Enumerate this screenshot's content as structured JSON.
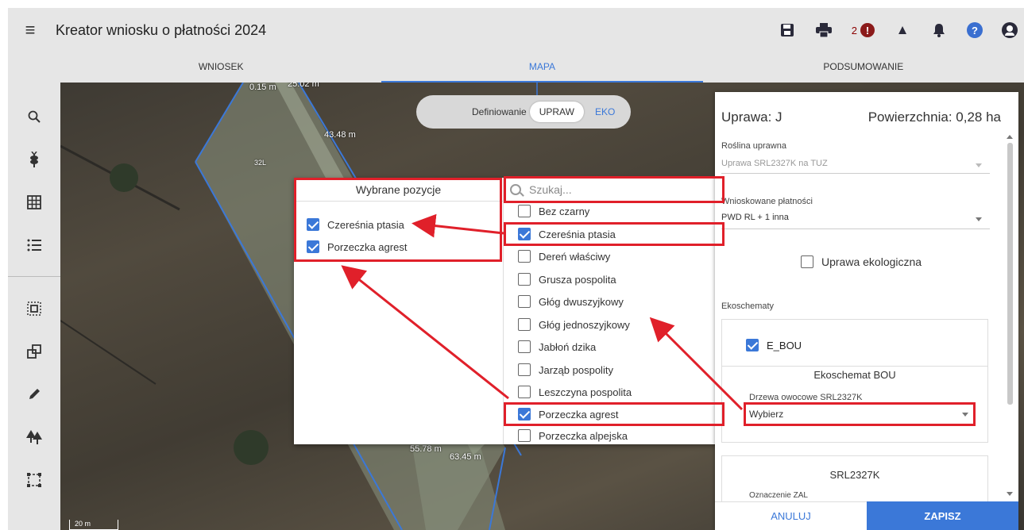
{
  "app_title": "Kreator wniosku o płatności 2024",
  "header": {
    "error_count": "2",
    "error_glyph": "!",
    "warning_glyph": "▲",
    "help_glyph": "?"
  },
  "tabs": [
    {
      "label": "WNIOSEK"
    },
    {
      "label": "MAPA"
    },
    {
      "label": "PODSUMOWANIE"
    }
  ],
  "map": {
    "labels": [
      "0.15 m",
      "25.02 m",
      "43.48 m",
      "32L",
      "63.45 m",
      "55.78 m"
    ],
    "scale": "20 m",
    "mode_toggle": {
      "prefix": "Definiowanie",
      "option_a": "UPRAW",
      "option_b": "EKO"
    }
  },
  "picker": {
    "selected_title": "Wybrane pozycje",
    "selected": [
      {
        "label": "Czereśnia ptasia",
        "checked": true
      },
      {
        "label": "Porzeczka agrest",
        "checked": true
      }
    ],
    "search_placeholder": "Szukaj...",
    "options": [
      {
        "label": "Bez czarny",
        "checked": false
      },
      {
        "label": "Czereśnia ptasia",
        "checked": true
      },
      {
        "label": "Dereń właściwy",
        "checked": false
      },
      {
        "label": "Grusza pospolita",
        "checked": false
      },
      {
        "label": "Głóg dwuszyjkowy",
        "checked": false
      },
      {
        "label": "Głóg jednoszyjkowy",
        "checked": false
      },
      {
        "label": "Jabłoń dzika",
        "checked": false
      },
      {
        "label": "Jarząb pospolity",
        "checked": false
      },
      {
        "label": "Leszczyna pospolita",
        "checked": false
      },
      {
        "label": "Porzeczka agrest",
        "checked": true
      },
      {
        "label": "Porzeczka alpejska",
        "checked": false
      }
    ]
  },
  "panel": {
    "crop_title": "Uprawa: J",
    "area": "Powierzchnia: 0,28 ha",
    "plant_label": "Roślina uprawna",
    "plant_value": "Uprawa SRL2327K na TUZ",
    "payments_label": "Wnioskowane płatności",
    "payments_value": "PWD RL + 1 inna",
    "organic_label": "Uprawa ekologiczna",
    "eco_label": "Ekoschematy",
    "eco_checkbox": "E_BOU",
    "eco_card_title": "Ekoschemat BOU",
    "trees_label": "Drzewa owocowe SRL2327K",
    "trees_value": "Wybierz",
    "srl_title": "SRL2327K",
    "zal_label": "Oznaczenie ZAL",
    "cancel": "ANULUJ",
    "save": "ZAPISZ"
  },
  "colors": {
    "accent": "#3b78d8",
    "highlight": "#e0202a",
    "error": "#8b1a1a"
  }
}
